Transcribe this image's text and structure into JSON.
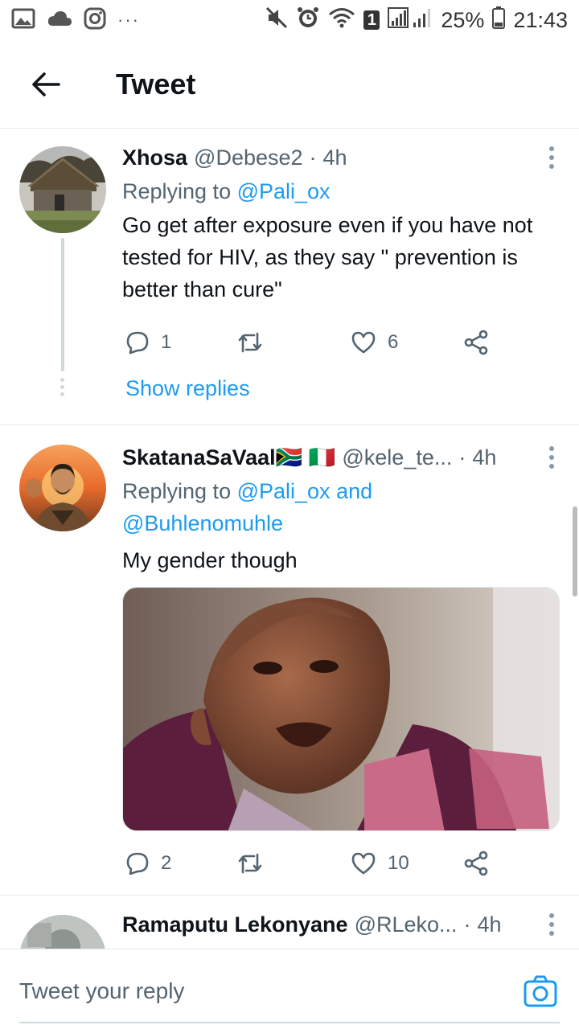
{
  "status_bar": {
    "dots": "···",
    "battery": "25%",
    "time": "21:43",
    "sim_badge": "1",
    "icons": [
      "gallery-icon",
      "cloud-icon",
      "instagram-icon",
      "mute-icon",
      "alarm-icon",
      "wifi-icon",
      "signal-icon",
      "battery-icon"
    ]
  },
  "header": {
    "title": "Tweet",
    "back_icon": "arrow-left-icon"
  },
  "tweets": [
    {
      "name": "Xhosa",
      "handle": "@Debese2",
      "time": "4h",
      "replying_prefix": "Replying to ",
      "mentions": [
        "@Pali_ox"
      ],
      "text": "Go get after exposure even if you have not tested for HIV, as they say \" prevention is better than cure\"",
      "replies": "1",
      "retweets": "",
      "likes": "6",
      "show_replies": "Show replies"
    },
    {
      "name": "SkatanaSaVaal🇿🇦 🇮🇹",
      "handle": "@kele_te...",
      "time": "4h",
      "replying_prefix": "Replying to ",
      "mentions": [
        "@Pali_ox",
        "and",
        "@Buhlenomuhle"
      ],
      "text": "My gender though",
      "replies": "2",
      "retweets": "",
      "likes": "10"
    },
    {
      "name": "Ramaputu Lekonyane",
      "handle": "@RLeko...",
      "time": "4h"
    }
  ],
  "reply_bar": {
    "placeholder": "Tweet your reply",
    "camera_icon": "camera-icon"
  },
  "colors": {
    "accent": "#1d9bf0",
    "text": "#0f1419",
    "secondary": "#536471",
    "border": "#e6e9ec"
  }
}
